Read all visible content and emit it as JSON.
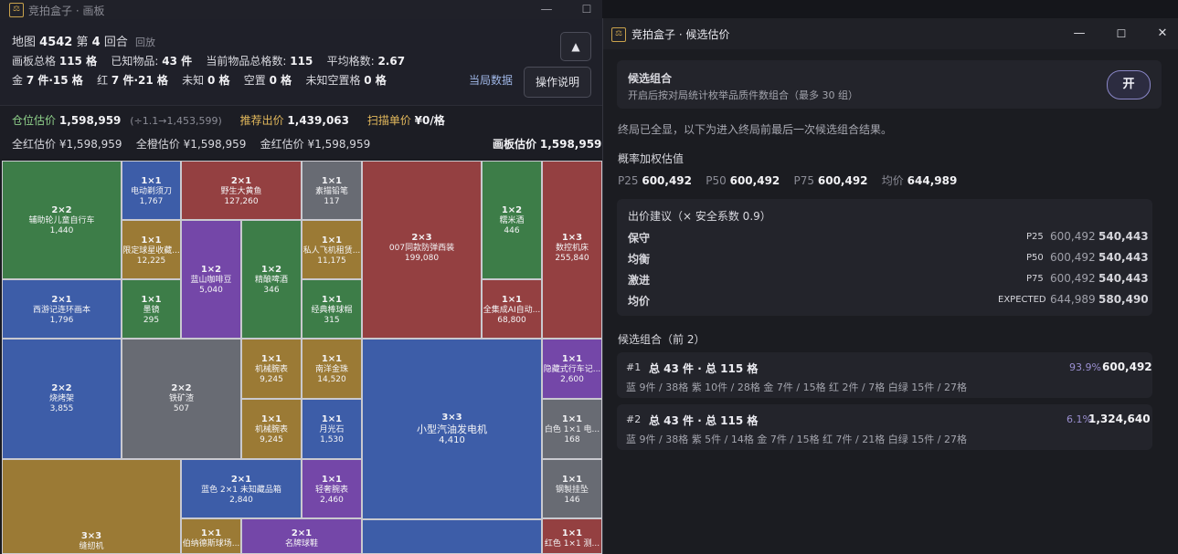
{
  "board_window": {
    "title": "竞拍盒子 · 画板",
    "controls": {
      "minimize": "—",
      "maximize": "☐",
      "close": "✕"
    },
    "header": {
      "map_label": "地图",
      "map_id": "4542",
      "round_pre": "第",
      "round": "4",
      "round_post": "回合",
      "replay": "回放",
      "stats1": {
        "total_label": "画板总格",
        "total": "115 格",
        "known_label": "已知物品:",
        "known": "43 件",
        "items_cells_label": "当前物品总格数:",
        "items_cells": "115",
        "avg_label": "平均格数:",
        "avg": "2.67"
      },
      "stats2": {
        "gold_label": "金",
        "gold": "7 件·15 格",
        "red_label": "红",
        "red": "7 件·21 格",
        "unknown_label": "未知",
        "unknown": "0 格",
        "empty_label": "空置",
        "empty": "0 格",
        "unknown_empty_label": "未知空置格",
        "unknown_empty": "0 格"
      },
      "round_data_link": "当局数据",
      "ops_button": "操作说明",
      "pin_icon": "pin-icon"
    },
    "estimates": {
      "cang_label": "仓位估价",
      "cang": "1,598,959",
      "cang_range": "(÷1.1→1,453,599)",
      "bid_label": "推荐出价",
      "bid": "1,439,063",
      "scan_label": "扫描单价",
      "scan": "¥0/格",
      "allred_label": "全红估价",
      "allred": "¥1,598,959",
      "allorange_label": "全橙估价",
      "allorange": "¥1,598,959",
      "goldred_label": "金红估价",
      "goldred": "¥1,598,959",
      "board_label": "画板估价",
      "board": "1,598,959"
    },
    "cells": [
      {
        "size": "2×2",
        "name": "辅助轮儿童自行车",
        "value": "1,440"
      },
      {
        "size": "2×1",
        "name": "西游记连环画本",
        "value": "1,796"
      },
      {
        "size": "2×2",
        "name": "烧烤架",
        "value": "3,855"
      },
      {
        "size": "3×3",
        "name": "缝纫机",
        "value": ""
      },
      {
        "size": "1×1",
        "name": "电动剃须刀",
        "value": "1,767"
      },
      {
        "size": "1×1",
        "name": "限定球星收藏...",
        "value": "12,225"
      },
      {
        "size": "1×1",
        "name": "墨镜",
        "value": "295"
      },
      {
        "size": "2×2",
        "name": "铁矿渣",
        "value": "507"
      },
      {
        "size": "2×1",
        "name": "蓝色 2×1 未知藏品箱",
        "value": "2,840"
      },
      {
        "size": "1×1",
        "name": "伯纳德斯球场...",
        "value": ""
      },
      {
        "size": "2×1",
        "name": "野生大黄鱼",
        "value": "127,260"
      },
      {
        "size": "1×2",
        "name": "蓝山咖啡豆",
        "value": "5,040"
      },
      {
        "size": "1×2",
        "name": "精酿啤酒",
        "value": "346"
      },
      {
        "size": "1×1",
        "name": "机械腕表",
        "value": "9,245"
      },
      {
        "size": "1×1",
        "name": "机械腕表",
        "value": "9,245"
      },
      {
        "size": "2×1",
        "name": "名牌球鞋",
        "value": ""
      },
      {
        "size": "1×1",
        "name": "素描铅笔",
        "value": "117"
      },
      {
        "size": "1×1",
        "name": "私人飞机租赁...",
        "value": "11,175"
      },
      {
        "size": "1×1",
        "name": "经典棒球帽",
        "value": "315"
      },
      {
        "size": "1×1",
        "name": "南洋金珠",
        "value": "14,520"
      },
      {
        "size": "1×1",
        "name": "月光石",
        "value": "1,530"
      },
      {
        "size": "1×1",
        "name": "轻奢腕表",
        "value": "2,460"
      },
      {
        "size": "2×3",
        "name": "007同款防弹西装",
        "value": "199,080"
      },
      {
        "size": "3×3",
        "name": "小型汽油发电机",
        "value": "4,410"
      },
      {
        "size": "1×2",
        "name": "糯米酒",
        "value": "446"
      },
      {
        "size": "1×1",
        "name": "全集成AI自动...",
        "value": "68,800"
      },
      {
        "size": "1×3",
        "name": "数控机床",
        "value": "255,840"
      },
      {
        "size": "1×1",
        "name": "隐藏式行车记...",
        "value": "2,600"
      },
      {
        "size": "1×1",
        "name": "白色 1×1 电...",
        "value": "168"
      },
      {
        "size": "1×1",
        "name": "钢製挂坠",
        "value": "146"
      },
      {
        "size": "1×1",
        "name": "红色 1×1 测...",
        "value": ""
      }
    ]
  },
  "candidate_window": {
    "title": "竞拍盒子 · 候选估价",
    "controls": {
      "minimize": "—",
      "maximize": "☐",
      "close": "✕"
    },
    "combo": {
      "title": "候选组合",
      "desc": "开启后按对局统计枚举品质件数组合（最多 30 组）",
      "toggle": "开"
    },
    "note": "终局已全显，以下为进入终局前最后一次候选组合结果。",
    "weighted": {
      "title": "概率加权估值",
      "p25_label": "P25",
      "p25": "600,492",
      "p50_label": "P50",
      "p50": "600,492",
      "p75_label": "P75",
      "p75": "600,492",
      "avg_label": "均价",
      "avg": "644,989"
    },
    "bid_advice": {
      "title": "出价建议（× 安全系数 0.9）",
      "rows": [
        {
          "label": "保守",
          "key": "P25",
          "base": "600,492",
          "bid": "540,443"
        },
        {
          "label": "均衡",
          "key": "P50",
          "base": "600,492",
          "bid": "540,443"
        },
        {
          "label": "激进",
          "key": "P75",
          "base": "600,492",
          "bid": "540,443"
        },
        {
          "label": "均价",
          "key": "EXPECTED",
          "base": "644,989",
          "bid": "580,490"
        }
      ]
    },
    "candidates_title": "候选组合（前 2）",
    "candidates": [
      {
        "rank": "#1",
        "summary": "总 43 件 · 总 115 格",
        "pct": "93.9%",
        "value": "600,492",
        "detail": "蓝 9件 / 38格   紫 10件 / 28格   金 7件 / 15格   红 2件 / 7格   白绿 15件 / 27格"
      },
      {
        "rank": "#2",
        "summary": "总 43 件 · 总 115 格",
        "pct": "6.1%",
        "value": "1,324,640",
        "detail": "蓝 9件 / 38格   紫 5件 / 14格   金 7件 / 15格   红 7件 / 21格   白绿 15件 / 27格"
      }
    ]
  },
  "colors": {
    "green": "#3d7d48",
    "blue": "#3d5da8",
    "red": "#944041",
    "gold": "#9b7a35",
    "gray": "#686b73",
    "purple": "#7447a8",
    "accent_gold": "#e3b95c",
    "accent_green": "#8fd18a"
  }
}
